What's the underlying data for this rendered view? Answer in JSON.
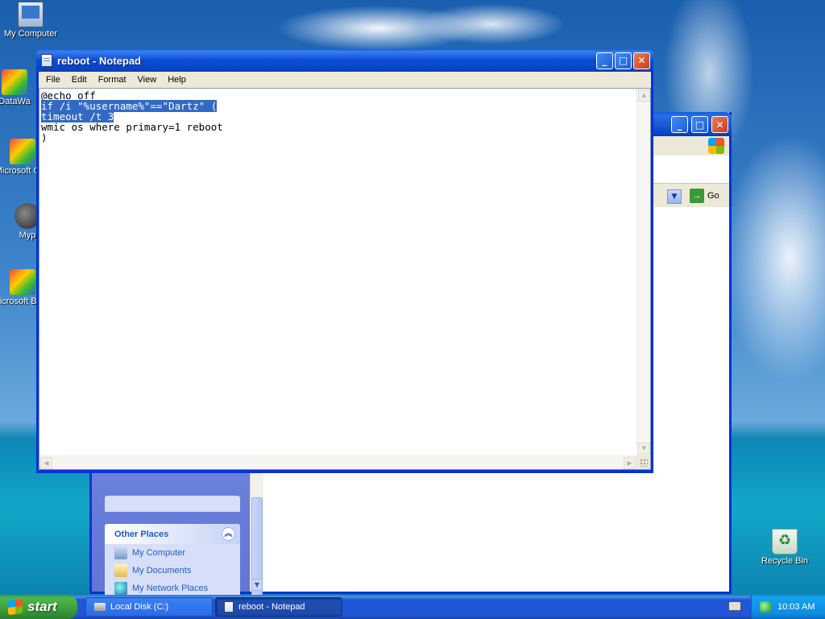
{
  "desktop": {
    "icons": [
      {
        "label": "My Computer"
      },
      {
        "label": "DataWa"
      },
      {
        "label": "Microsoft C++"
      },
      {
        "label": "Myp"
      },
      {
        "label": "Microsoft Basic"
      },
      {
        "label": "Recycle Bin"
      }
    ]
  },
  "explorer": {
    "go_label": "Go",
    "other_places": {
      "title": "Other Places",
      "links": [
        "My Computer",
        "My Documents",
        "My Network Places"
      ]
    }
  },
  "notepad": {
    "title": "reboot - Notepad",
    "menu": [
      "File",
      "Edit",
      "Format",
      "View",
      "Help"
    ],
    "lines": [
      {
        "text": "@echo off",
        "selected": false
      },
      {
        "text": "if /i \"%username%\"==\"Dartz\" (",
        "selected": true
      },
      {
        "text": "timeout /t 3",
        "selected": true
      },
      {
        "text": "wmic os where primary=1 reboot",
        "selected": false
      },
      {
        "text": ")",
        "selected": false
      }
    ]
  },
  "taskbar": {
    "start_label": "start",
    "tasks": [
      {
        "label": "Local Disk (C:)",
        "active": false
      },
      {
        "label": "reboot - Notepad",
        "active": true
      }
    ],
    "clock": "10:03 AM"
  }
}
